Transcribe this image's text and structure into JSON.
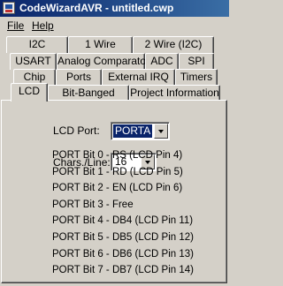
{
  "window": {
    "title": "CodeWizardAVR - untitled.cwp",
    "icon": "codewizard-app-icon"
  },
  "menu": {
    "file": "File",
    "help": "Help"
  },
  "tabs": {
    "row1": [
      "I2C",
      "1 Wire",
      "2 Wire (I2C)"
    ],
    "row2": [
      "USART",
      "Analog Comparator",
      "ADC",
      "SPI"
    ],
    "row3": [
      "Chip",
      "Ports",
      "External IRQ",
      "Timers"
    ],
    "row4": [
      "LCD",
      "Bit-Banged",
      "Project Information"
    ],
    "active": "LCD"
  },
  "lcd": {
    "port_label": "LCD Port:",
    "port_value": "PORTA",
    "chars_label": "Chars./Line:",
    "chars_value": "16",
    "pins": [
      "PORT Bit 0 - RS  (LCD Pin 4)",
      "PORT Bit 1 - RD  (LCD Pin 5)",
      "PORT Bit 2 - EN  (LCD Pin 6)",
      "PORT Bit 3 - Free",
      "PORT Bit 4 - DB4 (LCD Pin 11)",
      "PORT Bit 5 - DB5 (LCD Pin 12)",
      "PORT Bit 6 - DB6 (LCD Pin 13)",
      "PORT Bit 7 - DB7 (LCD Pin 14)"
    ]
  }
}
